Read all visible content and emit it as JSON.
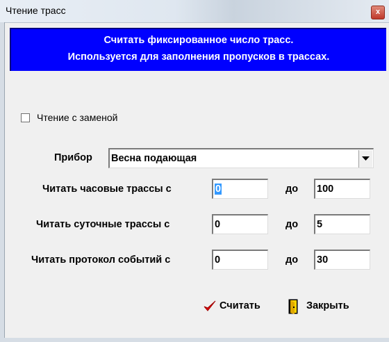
{
  "window": {
    "title": "Чтение трасс",
    "close_label": "x"
  },
  "banner": {
    "line1": "Считать фиксированное число трасс.",
    "line2": "Используется для заполнения пропусков в трассах."
  },
  "replace_checkbox": {
    "label": "Чтение с заменой",
    "checked": false
  },
  "device": {
    "label": "Прибор",
    "value": "Весна подающая"
  },
  "hourly": {
    "label": "Читать часовые трассы с",
    "from": "0",
    "to_label": "до",
    "to": "100"
  },
  "daily": {
    "label": "Читать суточные трассы с",
    "from": "0",
    "to_label": "до",
    "to": "5"
  },
  "events": {
    "label": "Читать протокол событий с",
    "from": "0",
    "to_label": "до",
    "to": "30"
  },
  "buttons": {
    "read_label": "Считать",
    "close_label": "Закрыть"
  },
  "colors": {
    "banner_bg": "#0000ff",
    "banner_text": "#ffffff",
    "checkmark": "#e00000"
  }
}
